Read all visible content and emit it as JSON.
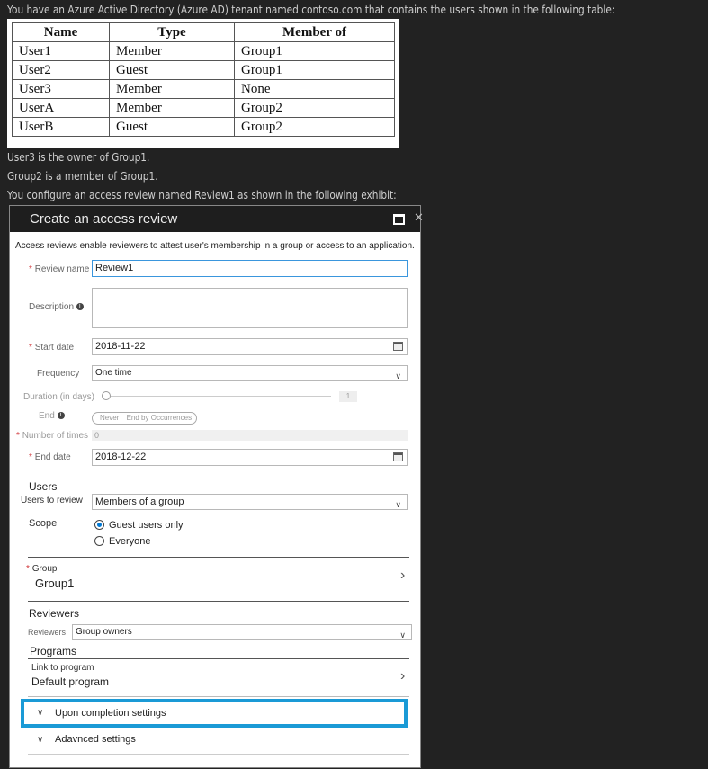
{
  "intro": {
    "line1": "You have an Azure Active Directory (Azure AD) tenant named contoso.com that contains the users shown in the following table:",
    "line2": "User3 is the owner of Group1.",
    "line3": "Group2 is a member of Group1.",
    "line4": "You configure an access review named Review1 as shown in the following exhibit:"
  },
  "users_table": {
    "headers": [
      "Name",
      "Type",
      "Member of"
    ],
    "rows": [
      [
        "User1",
        "Member",
        "Group1"
      ],
      [
        "User2",
        "Guest",
        "Group1"
      ],
      [
        "User3",
        "Member",
        "None"
      ],
      [
        "UserA",
        "Member",
        "Group2"
      ],
      [
        "UserB",
        "Guest",
        "Group2"
      ]
    ]
  },
  "panel": {
    "title": "Create an access review",
    "description": "Access reviews enable reviewers to attest user's membership in a group or access to an application.",
    "required_mark": "*",
    "review_name": {
      "label": "Review name",
      "value": "Review1"
    },
    "description_field": {
      "label": "Description",
      "value": ""
    },
    "start_date": {
      "label": "Start date",
      "value": "2018-11-22"
    },
    "frequency": {
      "label": "Frequency",
      "value": "One time"
    },
    "duration": {
      "label": "Duration (in days)",
      "value": "1"
    },
    "end": {
      "label": "End",
      "options": [
        "Never",
        "End by",
        "Occurrences"
      ]
    },
    "number_of_times": {
      "label": "Number of times",
      "value": "0"
    },
    "end_date": {
      "label": "End date",
      "value": "2018-12-22"
    },
    "users_section": "Users",
    "users_to_review": {
      "label": "Users to review",
      "value": "Members of a group"
    },
    "scope": {
      "label": "Scope",
      "options": [
        "Guest users only",
        "Everyone"
      ],
      "selected": "Guest users only"
    },
    "group": {
      "label": "Group",
      "value": "Group1"
    },
    "reviewers_section": "Reviewers",
    "reviewers": {
      "label": "Reviewers",
      "value": "Group owners"
    },
    "programs_section": "Programs",
    "link_to_program": {
      "label": "Link to program",
      "value": "Default program"
    },
    "upon_completion": "Upon completion settings",
    "advanced": "Adavnced settings"
  },
  "colors": {
    "accent": "#0078d4",
    "highlight_border": "#1a9ad6",
    "required": "#d13438",
    "page_bg": "#222222"
  }
}
